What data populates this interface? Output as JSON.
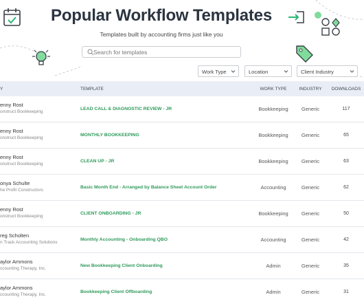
{
  "header": {
    "title": "Popular Workflow Templates",
    "subtitle": "Templates built by accounting firms just like you"
  },
  "search": {
    "placeholder": "Search for templates"
  },
  "filters": [
    {
      "label": "Work Type"
    },
    {
      "label": "Location"
    },
    {
      "label": "Client Industry"
    }
  ],
  "colors": {
    "accent_green": "#2e9a5a",
    "header_bg": "#e9eef6",
    "title": "#2b3440"
  },
  "icons": [
    "calendar-check-icon",
    "lightbulb-icon",
    "price-tag-icon",
    "login-arrow-icon",
    "shapes-icon",
    "magnifier-icon",
    "chevron-down-icon"
  ],
  "table": {
    "columns": {
      "owner": "Y",
      "template": "TEMPLATE",
      "work_type": "WORK TYPE",
      "industry": "INDUSTRY",
      "downloads": "DOWNLOADS"
    },
    "rows": [
      {
        "owner": "enny Rost",
        "org": "onstruct Bookkeeping",
        "template": "LEAD CALL & DIAGNOSTIC REVIEW - JR",
        "work_type": "Bookkeeping",
        "industry": "Generic",
        "downloads": "117"
      },
      {
        "owner": "enny Rost",
        "org": "onstruct Bookkeeping",
        "template": "MONTHLY BOOKKEEPING",
        "work_type": "Bookkeeping",
        "industry": "Generic",
        "downloads": "65"
      },
      {
        "owner": "enny Rost",
        "org": "onstruct Bookkeeping",
        "template": "CLEAN UP - JR",
        "work_type": "Bookkeeping",
        "industry": "Generic",
        "downloads": "63"
      },
      {
        "owner": "onya Schulte",
        "org": "he Profit Constructors",
        "template": "Basic Month End - Arranged by Balance Sheet Account Order",
        "work_type": "Accounting",
        "industry": "Generic",
        "downloads": "62"
      },
      {
        "owner": "enny Rost",
        "org": "onstruct Bookkeeping",
        "template": "CLIENT ONBOARDING - JR",
        "work_type": "Bookkeeping",
        "industry": "Generic",
        "downloads": "50"
      },
      {
        "owner": "reg Scholten",
        "org": "n Track Accounting Solutions",
        "template": "Monthly Accounting - Onboarding QBO",
        "work_type": "Accounting",
        "industry": "Generic",
        "downloads": "42"
      },
      {
        "owner": "aylor Ammons",
        "org": "ccounting Therapy, Inc.",
        "template": "New Bookkeeping Client Onboarding",
        "work_type": "Admin",
        "industry": "Generic",
        "downloads": "35"
      },
      {
        "owner": "aylor Ammons",
        "org": "ccounting Therapy, Inc.",
        "template": "Bookkeeping Client Offboarding",
        "work_type": "Admin",
        "industry": "Generic",
        "downloads": "31"
      }
    ]
  }
}
